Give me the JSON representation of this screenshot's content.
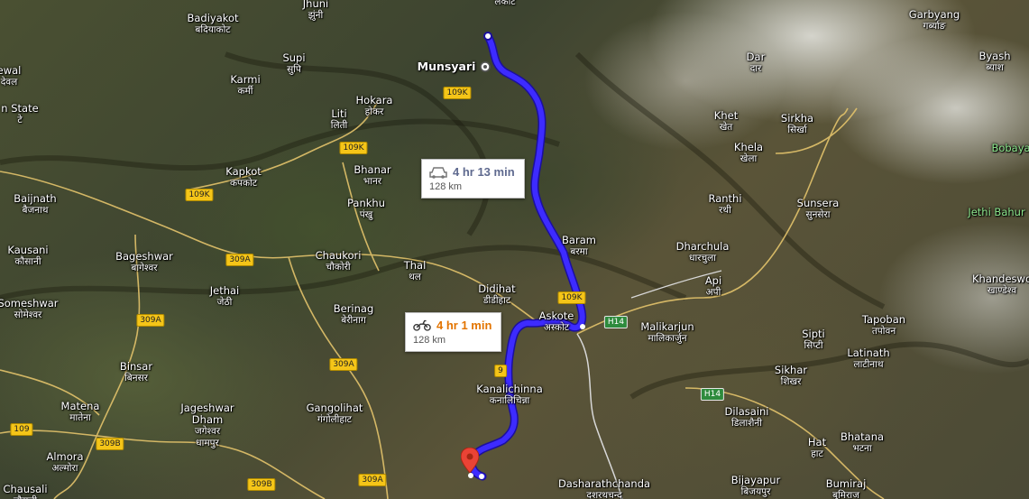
{
  "map": {
    "places": [
      {
        "id": "jhuni",
        "en": "Jhuni",
        "dev": "झुंनी"
      },
      {
        "id": "badiyakot",
        "en": "Badiyakot",
        "dev": "बदियाकोट"
      },
      {
        "id": "supi",
        "en": "Supi",
        "dev": "सुपि"
      },
      {
        "id": "karmi",
        "en": "Karmi",
        "dev": "कर्मी"
      },
      {
        "id": "hokara",
        "en": "Hokara",
        "dev": "होकर"
      },
      {
        "id": "liti",
        "en": "Liti",
        "dev": "लिती"
      },
      {
        "id": "ewal",
        "en": "ewal",
        "dev": "देवल"
      },
      {
        "id": "state",
        "en": "n State",
        "dev": "टे"
      },
      {
        "id": "kapkot",
        "en": "Kapkot",
        "dev": "कपकोट"
      },
      {
        "id": "bhanar",
        "en": "Bhanar",
        "dev": "भानर"
      },
      {
        "id": "pankhu",
        "en": "Pankhu",
        "dev": "पंखु"
      },
      {
        "id": "baijnath",
        "en": "Baijnath",
        "dev": "बैजनाथ"
      },
      {
        "id": "kausani",
        "en": "Kausani",
        "dev": "कौसानी"
      },
      {
        "id": "bageshwar",
        "en": "Bageshwar",
        "dev": "बागेश्वर"
      },
      {
        "id": "chaukori",
        "en": "Chaukori",
        "dev": "चौकोरी"
      },
      {
        "id": "thal",
        "en": "Thal",
        "dev": "थल"
      },
      {
        "id": "jethai",
        "en": "Jethai",
        "dev": "जेठी"
      },
      {
        "id": "someshwar",
        "en": "Someshwar",
        "dev": "सोमेश्वर"
      },
      {
        "id": "berinag",
        "en": "Berinag",
        "dev": "बेरीनाग"
      },
      {
        "id": "didihat",
        "en": "Didihat",
        "dev": "डीडीहाट"
      },
      {
        "id": "binsar",
        "en": "Binsar",
        "dev": "बिनसर"
      },
      {
        "id": "matena",
        "en": "Matena",
        "dev": "मातेना"
      },
      {
        "id": "jageshwar",
        "en": "Jageshwar\nDham",
        "dev": "जगेश्वर\nधामपुर"
      },
      {
        "id": "gangolihat",
        "en": "Gangolihat",
        "dev": "गंगोलीहाट"
      },
      {
        "id": "almora",
        "en": "Almora",
        "dev": "अल्मोरा"
      },
      {
        "id": "chausali",
        "en": "Chausali",
        "dev": "चौसली"
      },
      {
        "id": "kanalichinna",
        "en": "Kanalichinna",
        "dev": "कनालिचिन्ना"
      },
      {
        "id": "askote",
        "en": "Askote",
        "dev": "अस्कोट"
      },
      {
        "id": "baram",
        "en": "Baram",
        "dev": "बरमा"
      },
      {
        "id": "dharchula",
        "en": "Dharchula",
        "dev": "धारचुला"
      },
      {
        "id": "api",
        "en": "Api",
        "dev": "अपी"
      },
      {
        "id": "ranthi",
        "en": "Ranthi",
        "dev": "रथी"
      },
      {
        "id": "sunsera",
        "en": "Sunsera",
        "dev": "सुनसेरा"
      },
      {
        "id": "khela",
        "en": "Khela",
        "dev": "खेला"
      },
      {
        "id": "khet",
        "en": "Khet",
        "dev": "खेत"
      },
      {
        "id": "sirkha",
        "en": "Sirkha",
        "dev": "सिर्खा"
      },
      {
        "id": "dar",
        "en": "Dar",
        "dev": "दार"
      },
      {
        "id": "garbyang",
        "en": "Garbyang",
        "dev": "गर्ब्याङ"
      },
      {
        "id": "byash",
        "en": "Byash",
        "dev": "ब्याश"
      },
      {
        "id": "bobaya",
        "en": "Bobaya",
        "dev": ""
      },
      {
        "id": "jethibahur",
        "en": "Jethi Bahur",
        "dev": ""
      },
      {
        "id": "khandeswori",
        "en": "Khandeswo",
        "dev": "खाण्डेश्व"
      },
      {
        "id": "tapoban",
        "en": "Tapoban",
        "dev": "तपोवन"
      },
      {
        "id": "malikarjun",
        "en": "Malikarjun",
        "dev": "मालिकार्जुन"
      },
      {
        "id": "sipti",
        "en": "Sipti",
        "dev": "सिप्टी"
      },
      {
        "id": "latinath",
        "en": "Latinath",
        "dev": "लाटीनाथ"
      },
      {
        "id": "sikhar",
        "en": "Sikhar",
        "dev": "शिखर"
      },
      {
        "id": "dilasaini",
        "en": "Dilasaini",
        "dev": "डिलाशैनी"
      },
      {
        "id": "bhatana",
        "en": "Bhatana",
        "dev": "भटना"
      },
      {
        "id": "hat",
        "en": "Hat",
        "dev": "हाट"
      },
      {
        "id": "bijayapur",
        "en": "Bijayapur",
        "dev": "बिजयपुर"
      },
      {
        "id": "bumiraj",
        "en": "Bumiraj",
        "dev": "बुमिराज"
      },
      {
        "id": "dasharathchanda",
        "en": "Dasharathchanda",
        "dev": "दशरथचन्द"
      },
      {
        "id": "lekot",
        "en": "",
        "dev": "लेकोट"
      }
    ],
    "origin": {
      "en": "Munsyari"
    },
    "shields": [
      {
        "id": "r109k_1",
        "label": "109K"
      },
      {
        "id": "r109k_2",
        "label": "109K"
      },
      {
        "id": "r109k_3",
        "label": "109K"
      },
      {
        "id": "r109k_4",
        "label": "109K"
      },
      {
        "id": "r309a_1",
        "label": "309A"
      },
      {
        "id": "r309a_2",
        "label": "309A"
      },
      {
        "id": "r309a_3",
        "label": "309A"
      },
      {
        "id": "r309a_4",
        "label": "309A"
      },
      {
        "id": "r309b_1",
        "label": "309B"
      },
      {
        "id": "r309b_2",
        "label": "309B"
      },
      {
        "id": "r109",
        "label": "109"
      },
      {
        "id": "r9",
        "label": "9"
      },
      {
        "id": "h14_1",
        "label": "H14"
      },
      {
        "id": "h14_2",
        "label": "H14"
      }
    ]
  },
  "routes": {
    "car": {
      "time": "4 hr 13 min",
      "distance": "128 km",
      "color": "#5f6a8f"
    },
    "bike": {
      "time": "4 hr 1 min",
      "distance": "128 km",
      "color": "#e37400"
    }
  },
  "colors": {
    "route": "#3d2bff",
    "route_outline": "#1b0f9e",
    "roads": "#e3c36b",
    "border": "#d8d8d8"
  }
}
